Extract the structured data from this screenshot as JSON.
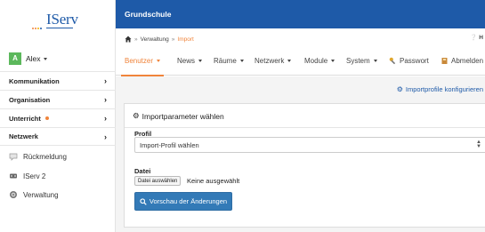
{
  "logo": {
    "text": "IServ",
    "dot_colors": [
      "#f0843b",
      "#f0843b",
      "#f6b400",
      "#1e5aa8"
    ]
  },
  "user": {
    "initial": "A",
    "name": "Alex"
  },
  "sidebar": {
    "sections": [
      {
        "label": "Kommunikation",
        "chevron": "›"
      },
      {
        "label": "Organisation",
        "chevron": "›"
      },
      {
        "label": "Unterricht",
        "chevron": "›",
        "badge": true
      },
      {
        "label": "Netzwerk",
        "chevron": "›"
      }
    ],
    "links": [
      {
        "label": "Rückmeldung",
        "icon": "feedback-icon"
      },
      {
        "label": "IServ 2",
        "icon": "iserv-icon"
      },
      {
        "label": "Verwaltung",
        "icon": "settings-icon"
      }
    ]
  },
  "topbar": {
    "title": "Grundschule"
  },
  "breadcrumb": {
    "home_icon": "home-icon",
    "sep": "»",
    "items": [
      "Verwaltung",
      "Import"
    ],
    "help": "H"
  },
  "tabs": [
    {
      "label": "Benutzer",
      "dropdown": true,
      "active": true
    },
    {
      "label": "News",
      "dropdown": true
    },
    {
      "label": "Räume",
      "dropdown": true
    },
    {
      "label": "Netzwerk",
      "dropdown": true
    },
    {
      "label": "Module",
      "dropdown": true
    },
    {
      "label": "System",
      "dropdown": true
    },
    {
      "label": "Passwort",
      "icon": "key-icon"
    },
    {
      "label": "Abmelden",
      "icon": "logout-icon"
    }
  ],
  "config_link": {
    "label": "Importprofile konfigurieren"
  },
  "panel": {
    "title": "Importparameter wählen",
    "profile_label": "Profil",
    "profile_value": "Import-Profil wählen",
    "file_label": "Datei",
    "file_button": "Datei auswählen",
    "file_status": "Keine ausgewählt",
    "submit": "Vorschau der Änderungen"
  },
  "colors": {
    "brand": "#1e5aa8",
    "accent": "#f0843b",
    "primary_button": "#337ab7"
  }
}
